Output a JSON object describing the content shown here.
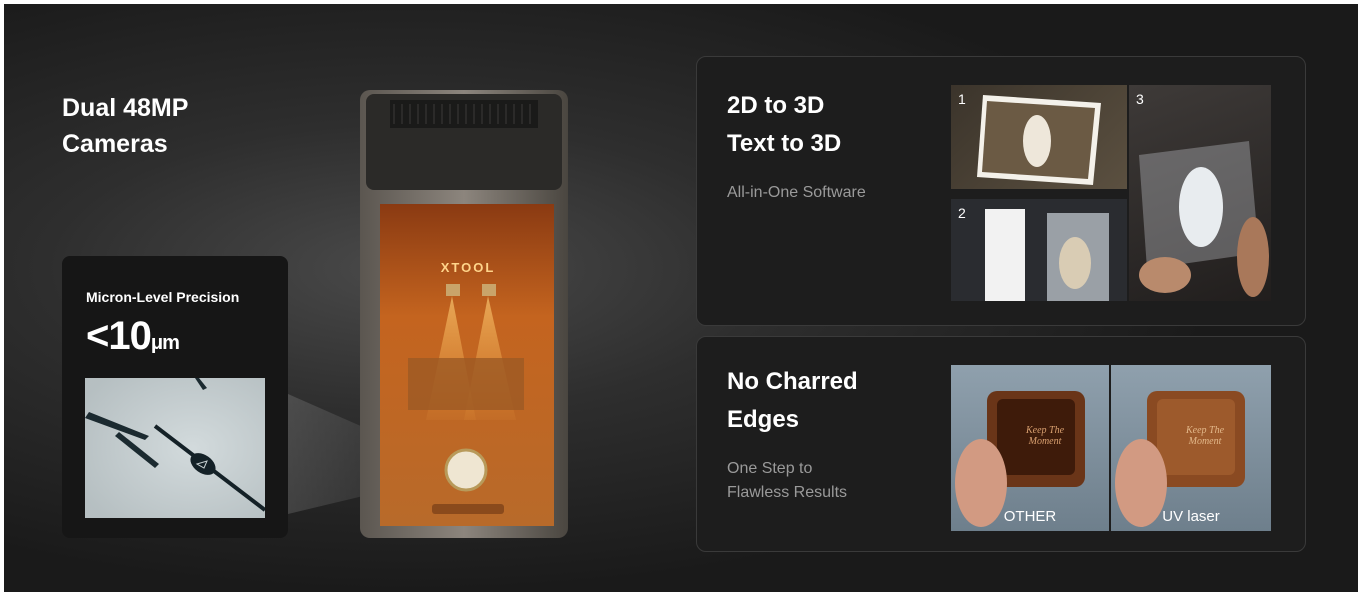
{
  "hero": {
    "headline_line1": "Dual 48MP",
    "headline_line2": "Cameras"
  },
  "precision_card": {
    "label": "Micron-Level Precision",
    "value": "<10",
    "unit": "μm"
  },
  "machine": {
    "brand": "XTOOL"
  },
  "feature_3d": {
    "title_line1": "2D to 3D",
    "title_line2": "Text to 3D",
    "subtitle": "All-in-One Software",
    "steps": [
      "1",
      "2",
      "3"
    ]
  },
  "feature_uv": {
    "title_line1": "No Charred",
    "title_line2": "Edges",
    "subtitle_line1": "One Step to",
    "subtitle_line2": "Flawless Results",
    "compare_left": "OTHER",
    "compare_right": "UV laser",
    "engraving_text": "Keep The Moment"
  }
}
